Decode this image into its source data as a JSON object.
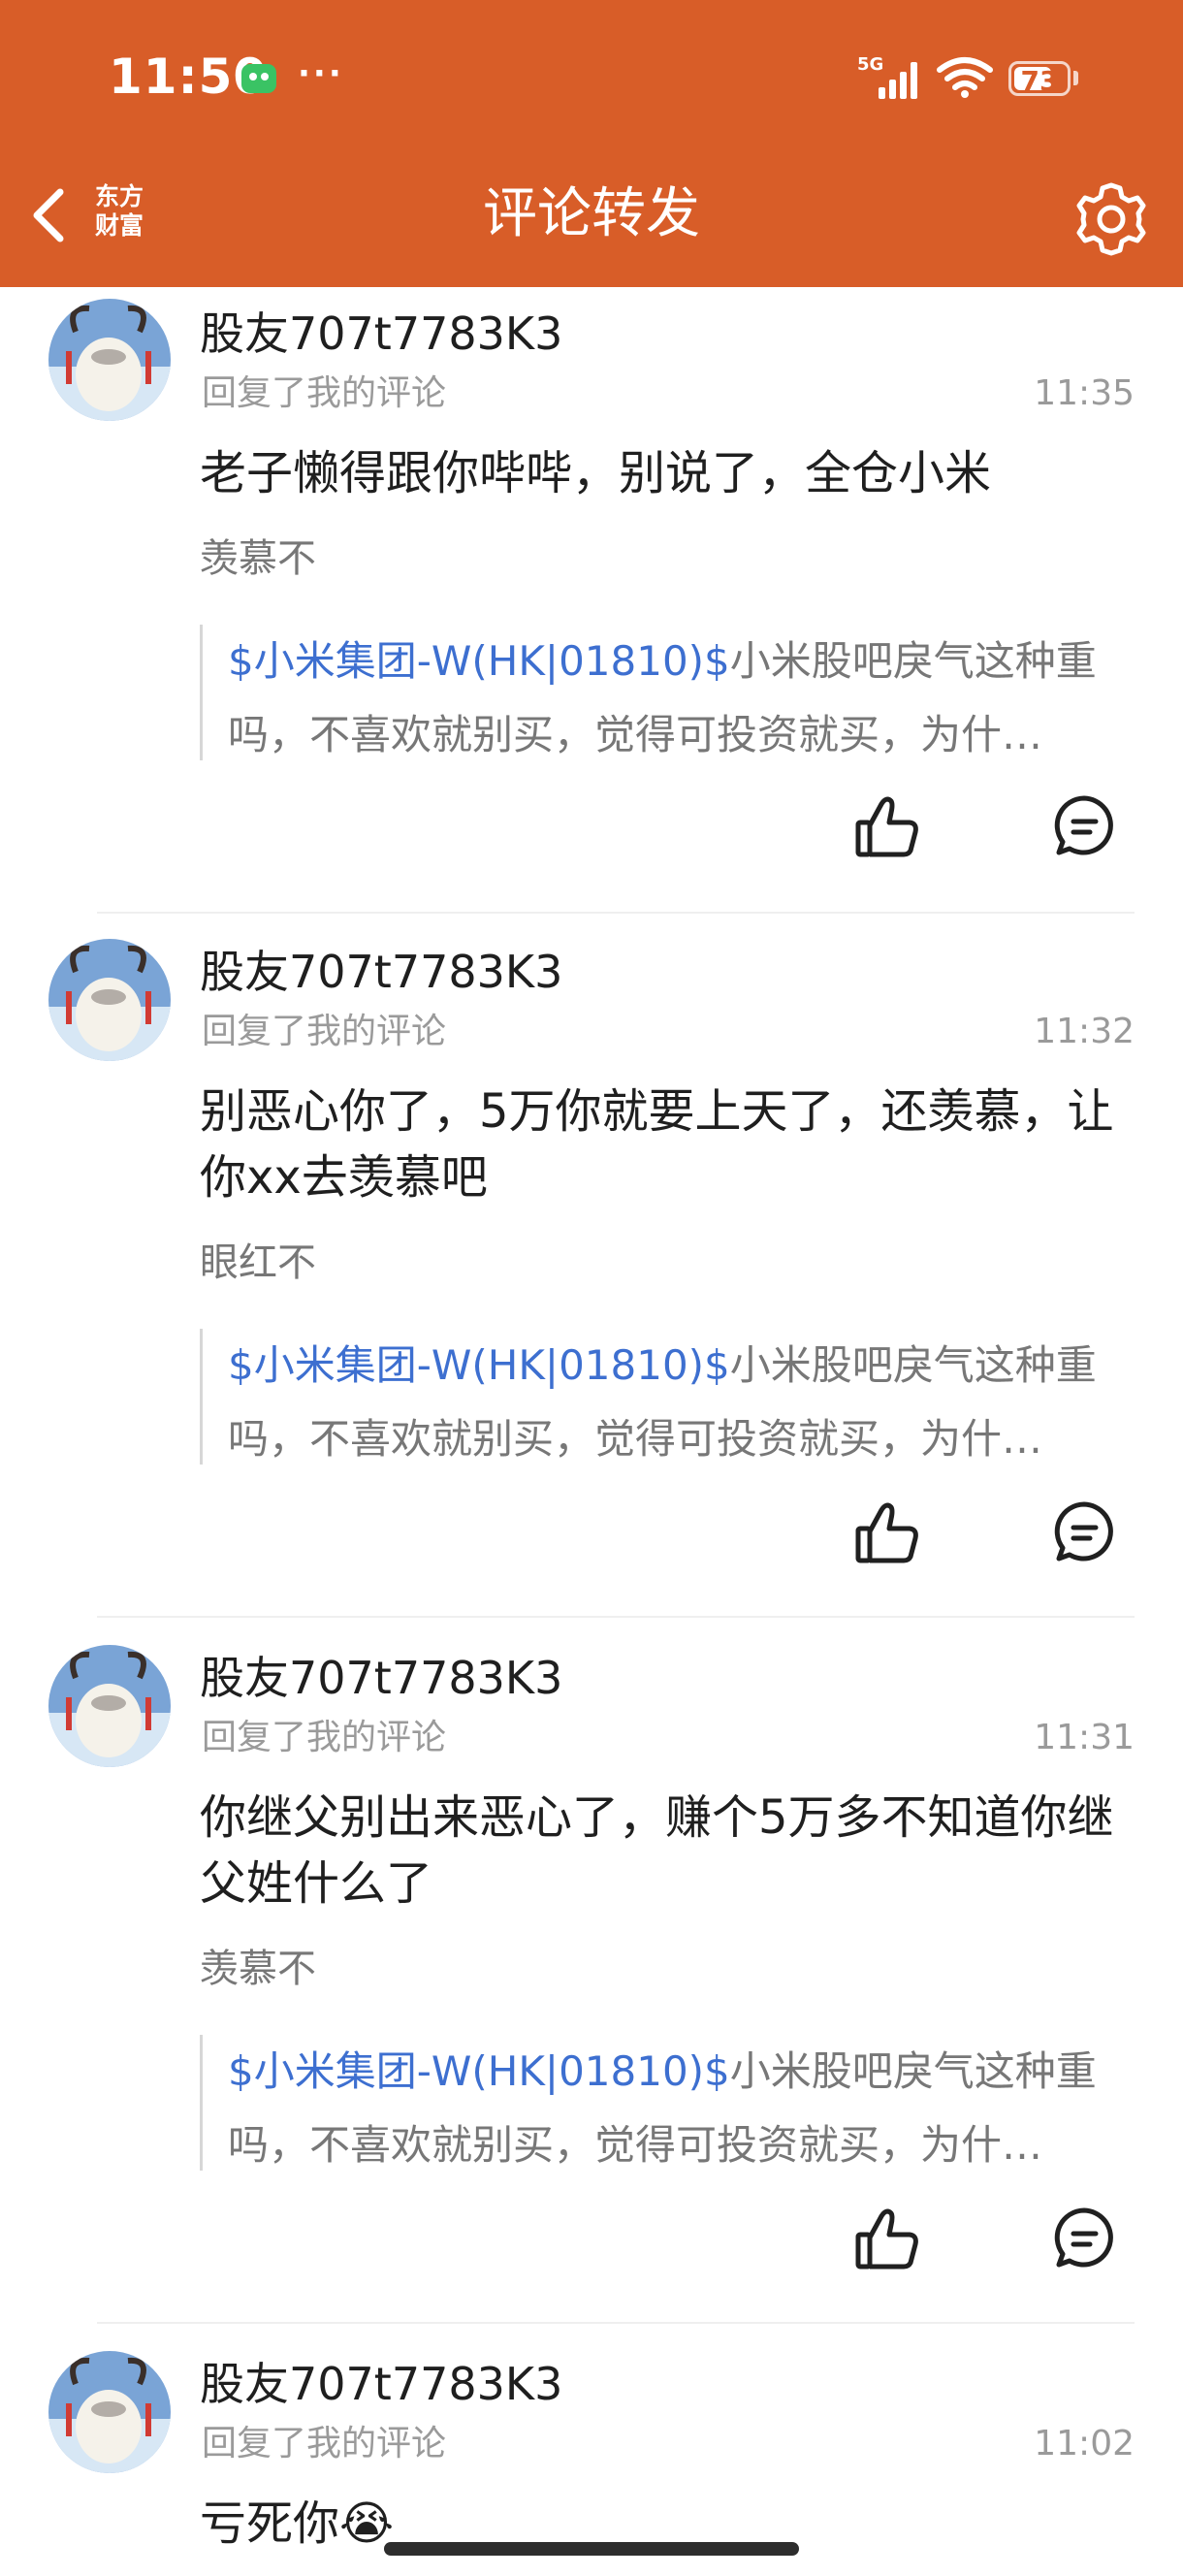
{
  "status_bar": {
    "time": "11:50",
    "dots": "···",
    "network": "5G",
    "battery": "73",
    "battery_level": 0.73,
    "app_icon": "wechat-icon",
    "signal_icon": "signal-icon",
    "wifi_icon": "wifi-icon"
  },
  "header": {
    "back_icon": "chevron-left-icon",
    "logo_text": "东方财富",
    "title": "评论转发",
    "settings_icon": "gear-icon"
  },
  "comments": [
    {
      "username": "股友707t7783K3",
      "action": "回复了我的评论",
      "time": "11:35",
      "text": "老子懒得跟你哔哔，别说了，全仓小米",
      "quoted": "羡慕不",
      "original_link": "$小米集团-W(HK|01810)$",
      "original_text": "小米股吧戾气这种重吗，不喜欢就别买，觉得可投资就买，为什…"
    },
    {
      "username": "股友707t7783K3",
      "action": "回复了我的评论",
      "time": "11:32",
      "text": "别恶心你了，5万你就要上天了，还羡慕，让你xx去羡慕吧",
      "quoted": "眼红不",
      "original_link": "$小米集团-W(HK|01810)$",
      "original_text": "小米股吧戾气这种重吗，不喜欢就别买，觉得可投资就买，为什…"
    },
    {
      "username": "股友707t7783K3",
      "action": "回复了我的评论",
      "time": "11:31",
      "text": "你继父别出来恶心了，赚个5万多不知道你继父姓什么了",
      "quoted": "羡慕不",
      "original_link": "$小米集团-W(HK|01810)$",
      "original_text": "小米股吧戾气这种重吗，不喜欢就别买，觉得可投资就买，为什…"
    },
    {
      "username": "股友707t7783K3",
      "action": "回复了我的评论",
      "time": "11:02",
      "text": "亏死你😭"
    }
  ],
  "colors": {
    "brand": "#d85d28",
    "link": "#3d6fd0",
    "muted": "#9a9a9a"
  }
}
